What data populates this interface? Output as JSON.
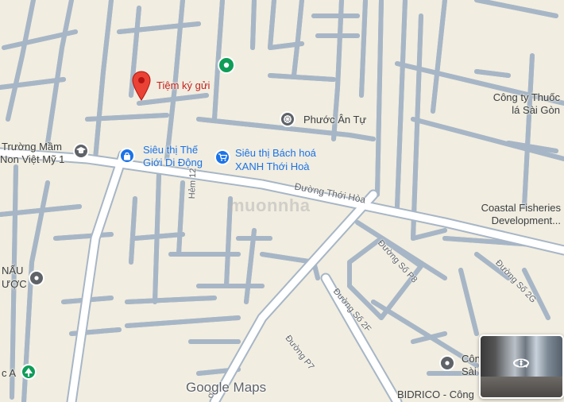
{
  "map": {
    "brand": "Google Maps",
    "watermark": "muonnha",
    "pois": {
      "selected_place": "Tiệm ký gửi",
      "temple": "Phước Ân Tự",
      "company_1_line1": "Công ty Thuốc",
      "company_1_line2": "lá Sài Gòn",
      "kindergarten_line1": "Trường Mầm",
      "kindergarten_line2": "Non Việt Mỹ 1",
      "store_1_line1": "Siêu thị Thế",
      "store_1_line2": "Giới Di Động",
      "store_2_line1": "Siêu thị Bách hoá",
      "store_2_line2": "XANH Thới Hoà",
      "coastal_line1": "Coastal Fisheries",
      "coastal_line2": "Development...",
      "left_poi_line1": "NẤU",
      "left_poi_line2": "ƯỢC",
      "bottom_left_poi": "c A",
      "bottom_right_line1": "Côn",
      "bottom_right_line2": "Sài",
      "bidrico": "BIDRICO - Công"
    },
    "roads": {
      "main": "Đường Thới Hòa",
      "hem12": "Hẻm 12",
      "p8": "Đường Số P8",
      "s2g": "Đường Số 2G",
      "s2f": "Đường Số 2F",
      "p7": "Đường P7",
      "edge_bottom": "ơi"
    },
    "colors": {
      "background": "#f1ede0",
      "road": "#a8b8c8",
      "road_casing": "#ffffff",
      "pin_red": "#ea4335",
      "poi_blue": "#1a73e8",
      "poi_gray": "#5f6368",
      "poi_green": "#0f9d58"
    },
    "street_view": {
      "icon": "rotate-360-icon"
    }
  }
}
